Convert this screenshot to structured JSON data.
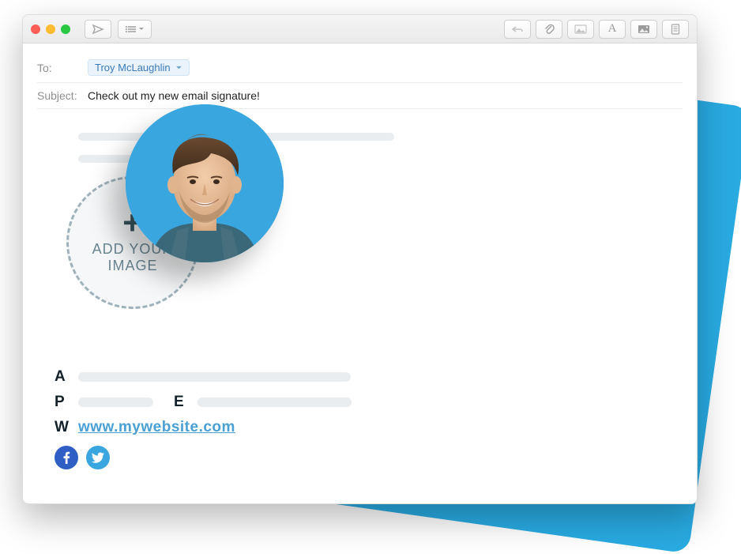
{
  "compose": {
    "to_label": "To:",
    "recipient": "Troy McLaughlin",
    "subject_label": "Subject:",
    "subject": "Check out my new email signature!"
  },
  "signature": {
    "add_image_line1": "ADD YOUR",
    "add_image_line2": "IMAGE",
    "plus": "+",
    "labels": {
      "address": "A",
      "phone": "P",
      "email": "E",
      "website": "W"
    },
    "website_url": "www.mywebsite.com"
  },
  "icons": {
    "send": "send-icon",
    "list": "list-icon",
    "reply": "reply-icon",
    "attach": "attach-icon",
    "mountain": "image-picker-icon",
    "font": "font-icon",
    "photo": "photo-icon",
    "page": "page-icon",
    "facebook": "facebook-icon",
    "twitter": "twitter-icon"
  }
}
